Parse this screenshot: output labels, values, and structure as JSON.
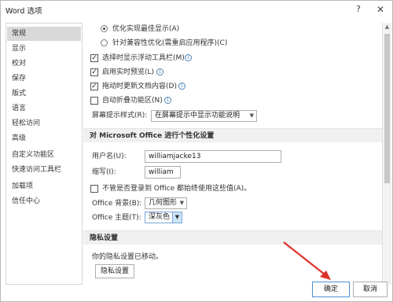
{
  "window": {
    "title": "Word 选项",
    "help": "?",
    "close": "✕"
  },
  "sidebar": {
    "items": [
      {
        "label": "常规",
        "active": true
      },
      {
        "label": "显示"
      },
      {
        "label": "校对"
      },
      {
        "label": "保存"
      },
      {
        "label": "版式"
      },
      {
        "label": "语言"
      },
      {
        "label": "轻松访问"
      },
      {
        "label": "高级"
      },
      {
        "label": "自定义功能区"
      },
      {
        "label": "快速访问工具栏"
      },
      {
        "label": "加载项"
      },
      {
        "label": "信任中心"
      }
    ]
  },
  "options": {
    "radio_optimize": "优化实现最佳显示(A)",
    "radio_compat": "针对兼容性优化(需重启应用程序)(C)",
    "cb_minitoolbar": "选择时显示浮动工具栏(M)",
    "cb_livepreview": "启用实时预览(L)",
    "cb_dragupdate": "拖动时更新文档内容(D)",
    "cb_collapse": "自动折叠功能区(N)",
    "tooltip_label": "屏幕提示样式(R):",
    "tooltip_value": "在屏幕提示中显示功能说明"
  },
  "personalize": {
    "header": "对 Microsoft Office 进行个性化设置",
    "username_label": "用户名(U):",
    "username_value": "williamjacke13",
    "initials_label": "缩写(I):",
    "initials_value": "william",
    "always_use_label": "不管是否登录到 Office 都始终使用这些值(A)。",
    "background_label": "Office 背景(B):",
    "background_value": "几何图形",
    "theme_label": "Office 主题(T):",
    "theme_value": "深灰色"
  },
  "privacy": {
    "header": "隐私设置",
    "moved_text": "你的隐私设置已移动。",
    "button": "隐私设置"
  },
  "footer": {
    "ok": "确定",
    "cancel": "取消"
  },
  "icons": {
    "checked": "✓",
    "info": "i",
    "dropdown": "▼",
    "scroll_up": "▲"
  },
  "colors": {
    "active_item": "#d9d9d9",
    "section_bg": "#f0f0f0",
    "annotation_arrow": "#e0302a",
    "focus_border": "#4d90d2"
  }
}
